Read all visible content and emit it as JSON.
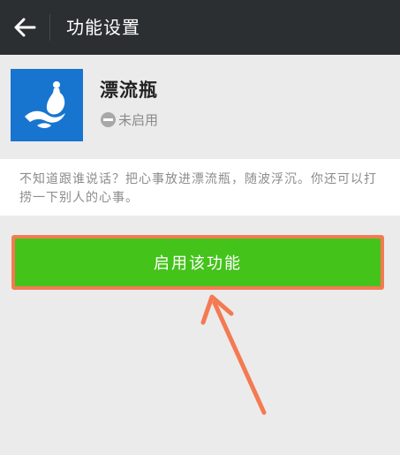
{
  "topbar": {
    "back_icon": "arrow-left-icon",
    "title": "功能设置"
  },
  "feature": {
    "logo_icon": "drift-bottle-icon",
    "name": "漂流瓶",
    "status_icon": "disabled-minus-icon",
    "status": "未启用"
  },
  "description": {
    "text": "不知道跟谁说话？把心事放进漂流瓶，随波浮沉。你还可以打捞一下别人的心事。"
  },
  "action": {
    "enable_label": "启用该功能"
  },
  "colors": {
    "topbar_bg": "#2c2f31",
    "logo_bg": "#1875cf",
    "button_green": "#44c31b",
    "annotation_orange": "#f47a52"
  }
}
